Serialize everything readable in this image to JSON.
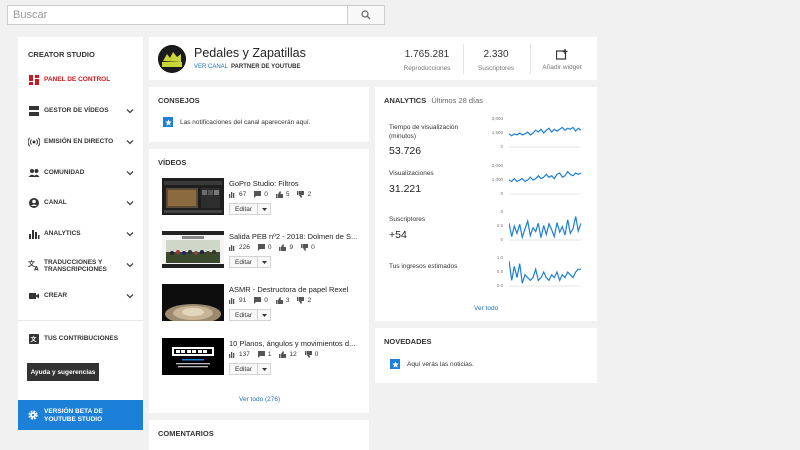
{
  "search": {
    "placeholder": "Buscar"
  },
  "sidebar": {
    "title": "CREATOR STUDIO",
    "items": [
      {
        "label": "PANEL DE CONTROL",
        "icon": "dashboard-icon",
        "active": true
      },
      {
        "label": "GESTOR DE VÍDEOS",
        "icon": "video-manager-icon"
      },
      {
        "label": "EMISIÓN EN DIRECTO",
        "icon": "live-icon"
      },
      {
        "label": "COMUNIDAD",
        "icon": "community-icon"
      },
      {
        "label": "CANAL",
        "icon": "channel-icon"
      },
      {
        "label": "ANALYTICS",
        "icon": "analytics-icon"
      },
      {
        "label": "TRADUCCIONES Y TRANSCRIPCIONES",
        "line1": "TRADUCCIONES Y",
        "line2": "TRANSCRIPCIONES",
        "icon": "translate-icon"
      },
      {
        "label": "CREAR",
        "icon": "create-icon"
      }
    ],
    "contrib": "TUS CONTRIBUCIONES",
    "help_label": "Ayuda y sugerencias",
    "beta_line1": "VERSIÓN BETA DE",
    "beta_line2": "YOUTUBE STUDIO"
  },
  "channel": {
    "name": "Pedales y Zapatillas",
    "view_link": "VER CANAL",
    "partner": "PARTNER DE YOUTUBE",
    "views_value": "1.765.281",
    "views_label": "Reproducciones",
    "subs_value": "2.330",
    "subs_label": "Suscriptores",
    "widget_label": "Añadir widget"
  },
  "consejos": {
    "title": "CONSEJOS",
    "tip": "Las notificaciones del canal aparecerán aquí."
  },
  "videos": {
    "title": "VÍDEOS",
    "edit_label": "Editar",
    "view_all": "Ver todo (276)",
    "items": [
      {
        "title": "GoPro Studio: Filtros",
        "views": "67",
        "comments": "0",
        "likes": "5",
        "dislikes": "2"
      },
      {
        "title": "Salida PEB nº2 - 2018: Dolmen de S...",
        "views": "226",
        "comments": "0",
        "likes": "9",
        "dislikes": "0"
      },
      {
        "title": "ASMR - Destructora de papel Rexel",
        "views": "91",
        "comments": "0",
        "likes": "3",
        "dislikes": "2"
      },
      {
        "title": "10 Planos, ángulos y movimientos d...",
        "views": "137",
        "comments": "1",
        "likes": "12",
        "dislikes": "0"
      }
    ]
  },
  "comentarios": {
    "title": "COMENTARIOS"
  },
  "analytics": {
    "title": "ANALYTICS",
    "period": "Últimos 28 días",
    "view_all": "Ver todo",
    "metrics": [
      {
        "label1": "Tiempo de visualización",
        "label2": "(minutos)",
        "value": "53.726",
        "ticks": [
          "3,000",
          "1,500",
          "0"
        ],
        "values": [
          1.4,
          1.2,
          1.4,
          1.3,
          1.5,
          1.3,
          1.4,
          1.6,
          1.3,
          1.5,
          1.8,
          1.6,
          1.9,
          1.5,
          1.8,
          2.0,
          1.6,
          1.9,
          1.7,
          1.9,
          2.1,
          1.8,
          2.0,
          1.9,
          2.1,
          1.7,
          2.0,
          1.8
        ]
      },
      {
        "label1": "Visualizaciones",
        "label2": "",
        "value": "31.221",
        "ticks": [
          "2,000",
          "1,000",
          "0"
        ],
        "values": [
          1.0,
          0.9,
          1.1,
          0.9,
          1.0,
          1.1,
          0.9,
          1.0,
          1.2,
          1.0,
          1.1,
          1.3,
          1.1,
          1.2,
          1.4,
          1.2,
          1.3,
          1.1,
          1.4,
          1.5,
          1.2,
          1.3,
          1.6,
          1.4,
          1.3,
          1.5,
          1.4,
          1.5
        ]
      },
      {
        "label1": "Suscriptores",
        "label2": "",
        "value": "+54",
        "ticks": [
          "5",
          "2.5",
          "0"
        ],
        "values": [
          3.0,
          0.6,
          2.5,
          1.2,
          2.8,
          0.5,
          2.0,
          3.4,
          0.8,
          2.2,
          1.5,
          3.0,
          0.4,
          2.6,
          1.0,
          2.9,
          1.8,
          0.6,
          3.1,
          1.4,
          2.4,
          0.9,
          3.6,
          1.2,
          2.0,
          4.2,
          1.6,
          3.0
        ]
      },
      {
        "label1": "Tus ingresos estimados",
        "label2": "",
        "value": "",
        "ticks": [
          "1.0",
          "0.5",
          "0.0"
        ],
        "values": [
          0.9,
          0.2,
          0.7,
          0.3,
          0.8,
          0.1,
          0.4,
          0.3,
          0.2,
          0.3,
          0.6,
          0.2,
          0.3,
          0.5,
          0.3,
          0.2,
          0.4,
          0.3,
          0.5,
          0.2,
          0.4,
          0.3,
          0.5,
          0.4,
          0.3,
          0.5,
          0.6,
          0.6
        ]
      }
    ]
  },
  "novedades": {
    "title": "NOVEDADES",
    "text": "Aquí verás las noticias."
  },
  "colors": {
    "accent": "#cc181e",
    "link": "#1f6fc7",
    "beta": "#1c7fd8",
    "spark": "#1c7fd8"
  }
}
